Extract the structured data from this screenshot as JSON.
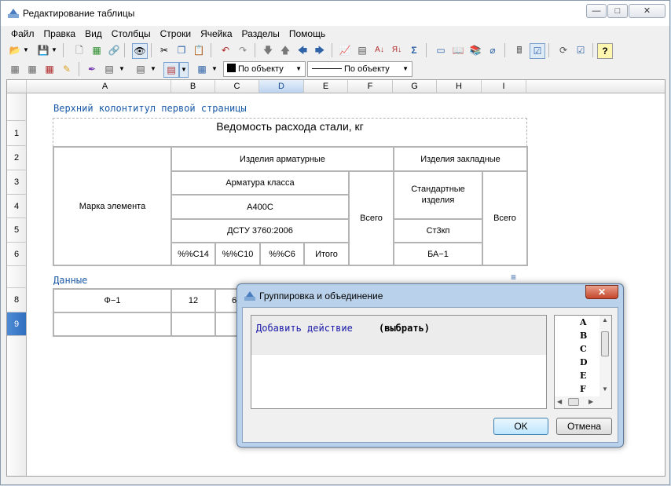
{
  "window": {
    "title": "Редактирование таблицы"
  },
  "menu": [
    "Файл",
    "Правка",
    "Вид",
    "Столбцы",
    "Строки",
    "Ячейка",
    "Разделы",
    "Помощь"
  ],
  "toolbar2": {
    "combo1": "По объекту",
    "combo2": "По объекту"
  },
  "sheet": {
    "columns": [
      "A",
      "B",
      "C",
      "D",
      "E",
      "F",
      "G",
      "H",
      "I"
    ],
    "rows": [
      "1",
      "2",
      "3",
      "4",
      "5",
      "6",
      "8",
      "9"
    ],
    "header_section": "Верхний колонтитул первой страницы",
    "data_section": "Данные",
    "title": "Ведомость расхода стали, кг",
    "cells": {
      "marka": "Марка элемента",
      "izd_arm": "Изделия арматурные",
      "izd_zakl": "Изделия закладные",
      "arm_klassa": "Арматура класса",
      "a400c": "А400С",
      "dstu": "ДСТУ 3760:2006",
      "vsego1": "Всего",
      "standart": "Стандартные изделия",
      "st3kp": "Ст3кп",
      "vsego2": "Всего",
      "c14": "%%С14",
      "c10": "%%С10",
      "c6": "%%С6",
      "itogo": "Итого",
      "ba1": "БА−1",
      "f1": "Ф−1",
      "v12": "12",
      "v6": "6"
    }
  },
  "dialog": {
    "title": "Группировка и объединение",
    "add_action": "Добавить действие",
    "choose": "(выбрать)",
    "letters": [
      "A",
      "B",
      "C",
      "D",
      "E",
      "F"
    ],
    "ok": "OK",
    "cancel": "Отмена"
  }
}
